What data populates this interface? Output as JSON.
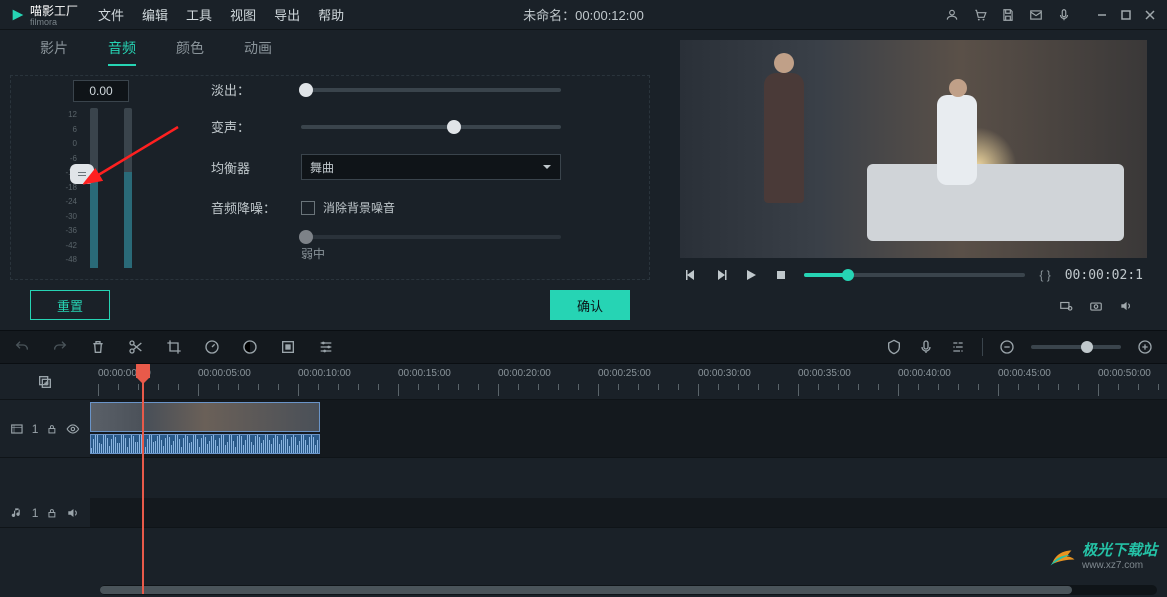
{
  "app": {
    "name": "喵影工厂",
    "subname": "filmora",
    "title": "未命名：00:00:12:00"
  },
  "menu": [
    "文件",
    "编辑",
    "工具",
    "视图",
    "导出",
    "帮助"
  ],
  "tabs": {
    "items": [
      "影片",
      "音频",
      "颜色",
      "动画"
    ],
    "active": 1
  },
  "audio": {
    "value": "0.00",
    "scale": [
      "12",
      "6",
      "0",
      "-6",
      "-12",
      "-18",
      "-24",
      "-30",
      "-36",
      "-42",
      "-48"
    ],
    "fadeout_label": "淡出：",
    "pitch_label": "变声：",
    "eq_label": "均衡器",
    "eq_value": "舞曲",
    "denoise_label": "音频降噪：",
    "denoise_check": "消除背景噪音",
    "noise_low": "弱",
    "noise_mid": "中",
    "reset": "重置",
    "confirm": "确认"
  },
  "preview": {
    "timecode": "00:00:02:1",
    "braces": "{   }"
  },
  "timeline": {
    "marks": [
      "00:00:00:00",
      "00:00:05:00",
      "00:00:10:00",
      "00:00:15:00",
      "00:00:20:00",
      "00:00:25:00",
      "00:00:30:00",
      "00:00:35:00",
      "00:00:40:00",
      "00:00:45:00",
      "00:00:50:00"
    ],
    "track_video": "1",
    "track_audio": "1"
  },
  "watermark": {
    "text": "极光下载站",
    "sub": "www.xz7.com"
  }
}
